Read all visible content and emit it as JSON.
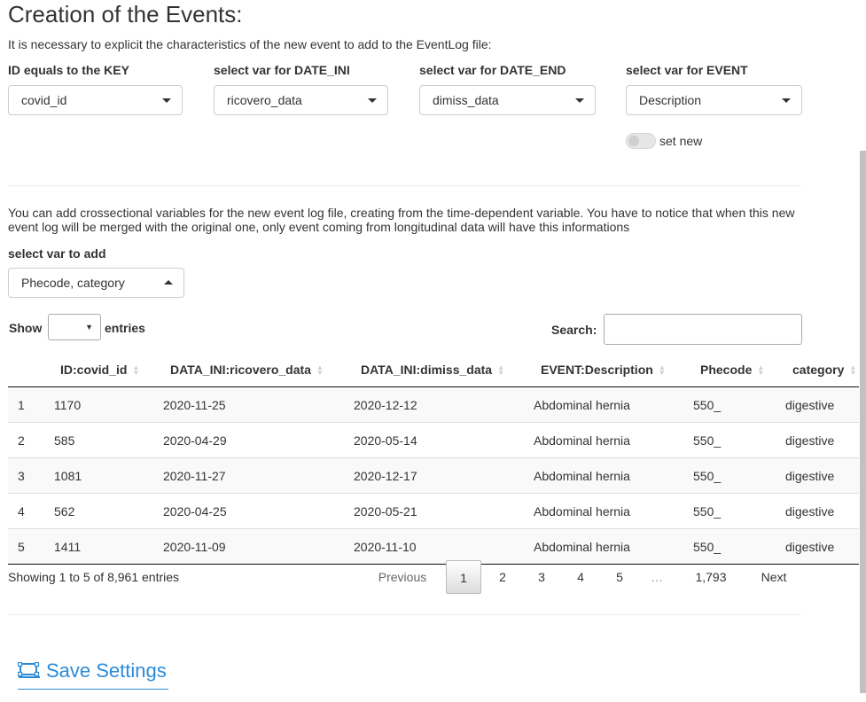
{
  "header": {
    "title": "Creation of the Events:",
    "intro": "It is necessary to explicit the characteristics of the new event to add to the EventLog file:"
  },
  "selectors": [
    {
      "label": "ID equals to the KEY",
      "value": "covid_id"
    },
    {
      "label": "select var for DATE_INI",
      "value": "ricovero_data"
    },
    {
      "label": "select var for DATE_END",
      "value": "dimiss_data"
    },
    {
      "label": "select var for EVENT",
      "value": "Description"
    }
  ],
  "toggle": {
    "label": "set new",
    "on": false
  },
  "crosssection": {
    "info": "You can add crossectional variables for the new event log file, creating from the time-dependent variable. You have to notice that when this new event log will be merged with the original one, only event coming from longitudinal data will have this informations",
    "label": "select var to add",
    "value": "Phecode, category"
  },
  "table_controls": {
    "show_label": "Show",
    "length_value": "",
    "entries_label": "entries",
    "search_label": "Search:",
    "search_value": ""
  },
  "table": {
    "columns": [
      "",
      "ID:covid_id",
      "DATA_INI:ricovero_data",
      "DATA_INI:dimiss_data",
      "EVENT:Description",
      "Phecode",
      "category"
    ],
    "rows": [
      [
        "1",
        "1170",
        "2020-11-25",
        "2020-12-12",
        "Abdominal hernia",
        "550_",
        "digestive"
      ],
      [
        "2",
        "585",
        "2020-04-29",
        "2020-05-14",
        "Abdominal hernia",
        "550_",
        "digestive"
      ],
      [
        "3",
        "1081",
        "2020-11-27",
        "2020-12-17",
        "Abdominal hernia",
        "550_",
        "digestive"
      ],
      [
        "4",
        "562",
        "2020-04-25",
        "2020-05-21",
        "Abdominal hernia",
        "550_",
        "digestive"
      ],
      [
        "5",
        "1411",
        "2020-11-09",
        "2020-11-10",
        "Abdominal hernia",
        "550_",
        "digestive"
      ]
    ]
  },
  "pagination": {
    "info": "Showing 1 to 5 of 8,961 entries",
    "previous": "Previous",
    "pages": [
      "1",
      "2",
      "3",
      "4",
      "5",
      "…",
      "1,793"
    ],
    "current": "1",
    "next": "Next"
  },
  "save_button": {
    "label": "Save Settings",
    "icon": "save-settings-icon",
    "color": "#2a8bd9"
  }
}
